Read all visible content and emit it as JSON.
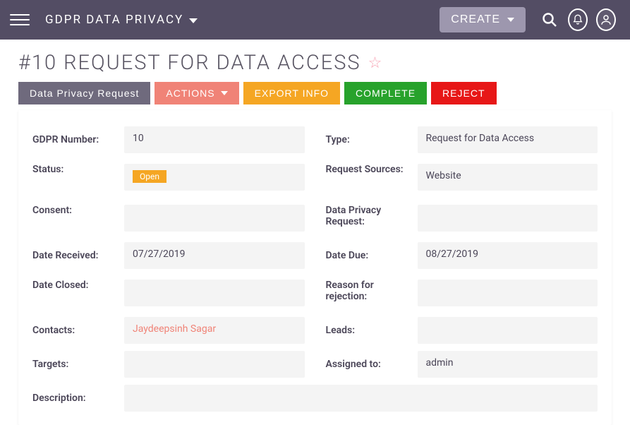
{
  "topbar": {
    "module_title": "GDPR DATA PRIVACY",
    "create_label": "CREATE"
  },
  "page": {
    "title": "#10 REQUEST FOR DATA ACCESS"
  },
  "actions": {
    "data_privacy_request": "Data Privacy Request",
    "actions": "ACTIONS",
    "export_info": "EXPORT INFO",
    "complete": "COMPLETE",
    "reject": "REJECT"
  },
  "fields": {
    "gdpr_number": {
      "label": "GDPR Number:",
      "value": "10"
    },
    "type": {
      "label": "Type:",
      "value": "Request for Data Access"
    },
    "status": {
      "label": "Status:",
      "badge": "Open"
    },
    "request_sources": {
      "label": "Request Sources:",
      "value": "Website"
    },
    "consent": {
      "label": "Consent:",
      "value": ""
    },
    "data_privacy_request": {
      "label": "Data Privacy Request:",
      "value": ""
    },
    "date_received": {
      "label": "Date Received:",
      "value": "07/27/2019"
    },
    "date_due": {
      "label": "Date Due:",
      "value": "08/27/2019"
    },
    "date_closed": {
      "label": "Date Closed:",
      "value": ""
    },
    "reason_for_rejection": {
      "label": "Reason for rejection:",
      "value": ""
    },
    "contacts": {
      "label": "Contacts:",
      "value": "Jaydeepsinh Sagar"
    },
    "leads": {
      "label": "Leads:",
      "value": ""
    },
    "targets": {
      "label": "Targets:",
      "value": ""
    },
    "assigned_to": {
      "label": "Assigned to:",
      "value": "admin"
    },
    "description": {
      "label": "Description:",
      "value": ""
    }
  }
}
